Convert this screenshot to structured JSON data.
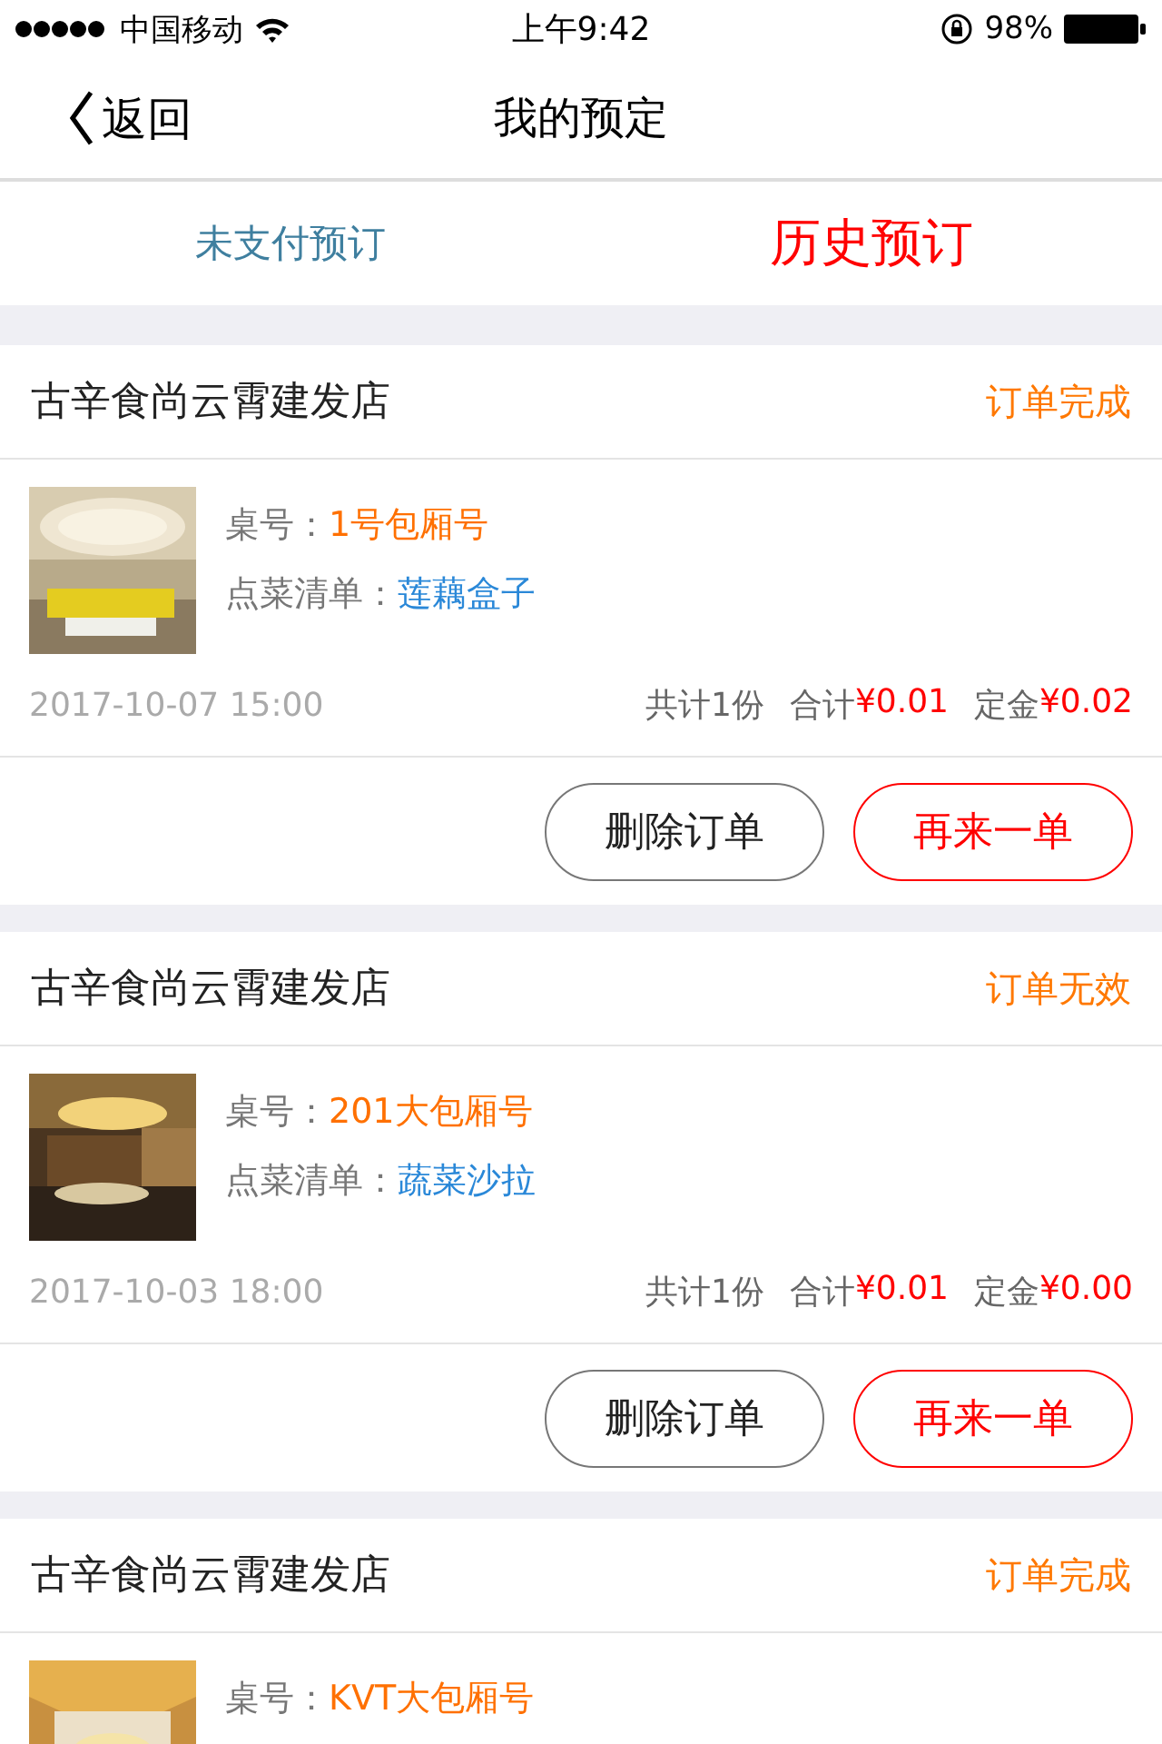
{
  "status_bar": {
    "carrier": "中国移动",
    "time": "上午9:42",
    "battery": "98%"
  },
  "nav": {
    "back": "返回",
    "title": "我的预定"
  },
  "tabs": [
    {
      "label": "未支付预订",
      "selected": false
    },
    {
      "label": "历史预订",
      "selected": true
    }
  ],
  "orders": [
    {
      "store": "古辛食尚云霄建发店",
      "status": "订单完成",
      "table_label": "桌号：",
      "table": "1号包厢号",
      "dishes_label": "点菜清单：",
      "dishes": "莲藕盒子",
      "date": "2017-10-07 15:00",
      "count": "共计1份",
      "total_label": "合计",
      "total": "¥0.01",
      "deposit_label": "定金",
      "deposit": "¥0.02",
      "buttons": [
        {
          "label": "删除订单",
          "kind": "outline"
        },
        {
          "label": "再来一单",
          "kind": "primary"
        }
      ]
    },
    {
      "store": "古辛食尚云霄建发店",
      "status": "订单无效",
      "table_label": "桌号：",
      "table": "201大包厢号",
      "dishes_label": "点菜清单：",
      "dishes": "蔬菜沙拉",
      "date": "2017-10-03 18:00",
      "count": "共计1份",
      "total_label": "合计",
      "total": "¥0.01",
      "deposit_label": "定金",
      "deposit": "¥0.00",
      "buttons": [
        {
          "label": "删除订单",
          "kind": "outline"
        },
        {
          "label": "再来一单",
          "kind": "primary"
        }
      ]
    },
    {
      "store": "古辛食尚云霄建发店",
      "status": "订单完成",
      "table_label": "桌号：",
      "table": "KVT大包厢号"
    }
  ]
}
